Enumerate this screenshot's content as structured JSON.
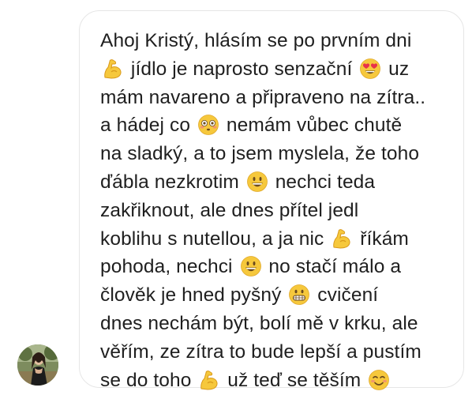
{
  "message": {
    "lines": [
      [
        {
          "t": "Ahoj Kristý, hlásím se po prvním dni"
        }
      ],
      [
        {
          "e": "muscle-icon"
        },
        {
          "t": " jídlo je naprosto senzační "
        },
        {
          "e": "heart-eyes-emoji"
        },
        {
          "t": " uz"
        }
      ],
      [
        {
          "t": "mám navareno a připraveno na zítra.."
        }
      ],
      [
        {
          "t": "a hádej co "
        },
        {
          "e": "flushed-emoji"
        },
        {
          "t": " nemám vůbec chutě"
        }
      ],
      [
        {
          "t": "na sladký, a to jsem myslela, že toho"
        }
      ],
      [
        {
          "t": "ďábla nezkrotim "
        },
        {
          "e": "grinning-emoji"
        },
        {
          "t": " nechci teda"
        }
      ],
      [
        {
          "t": "zakřiknout, ale dnes přítel jedl"
        }
      ],
      [
        {
          "t": "koblihu s nutellou, a ja nic "
        },
        {
          "e": "muscle-icon"
        },
        {
          "t": " říkám"
        }
      ],
      [
        {
          "t": "pohoda, nechci "
        },
        {
          "e": "grinning-emoji"
        },
        {
          "t": " no stačí málo a"
        }
      ],
      [
        {
          "t": "člověk je hned pyšný "
        },
        {
          "e": "grimacing-emoji"
        },
        {
          "t": " cvičení"
        }
      ],
      [
        {
          "t": "dnes nechám být, bolí mě v krku, ale"
        }
      ],
      [
        {
          "t": "věřím, ze zítra to bude lepší a pustím"
        }
      ],
      [
        {
          "t": "se do toho "
        },
        {
          "e": "muscle-icon"
        },
        {
          "t": " už teď se těším "
        },
        {
          "e": "smiling-blush-emoji"
        }
      ]
    ]
  },
  "colors": {
    "text": "#1f1f1f",
    "bubble_border": "#e6e6e6",
    "emoji_yellow": "#f6c83c",
    "emoji_dark": "#6b4a1e",
    "heart_red": "#e8324a"
  }
}
